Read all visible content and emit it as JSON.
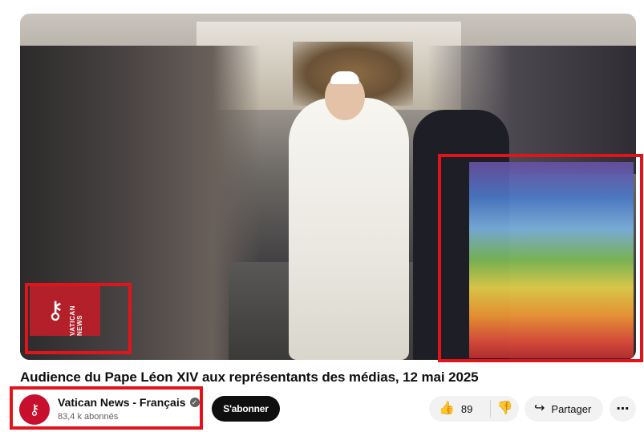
{
  "video": {
    "logo_glyph": "⚷",
    "logo_text": "VATICAN NEWS"
  },
  "title": "Audience du Pape Léon XIV aux représentants des médias, 12 mai 2025",
  "channel": {
    "name": "Vatican News - Français",
    "subscribers": "83,4 k abonnés",
    "verified_glyph": "✓",
    "avatar_glyph": "⚷"
  },
  "actions": {
    "subscribe_label": "S'abonner",
    "like_icon": "👍",
    "like_count": "89",
    "dislike_icon": "👎",
    "share_icon": "↪",
    "share_label": "Partager",
    "more_glyph": "⋯"
  },
  "colors": {
    "highlight": "#e1141c",
    "subscribe_bg": "#0f0f0f",
    "pill_bg": "#f2f2f2",
    "vatican_red": "#b3202a"
  }
}
